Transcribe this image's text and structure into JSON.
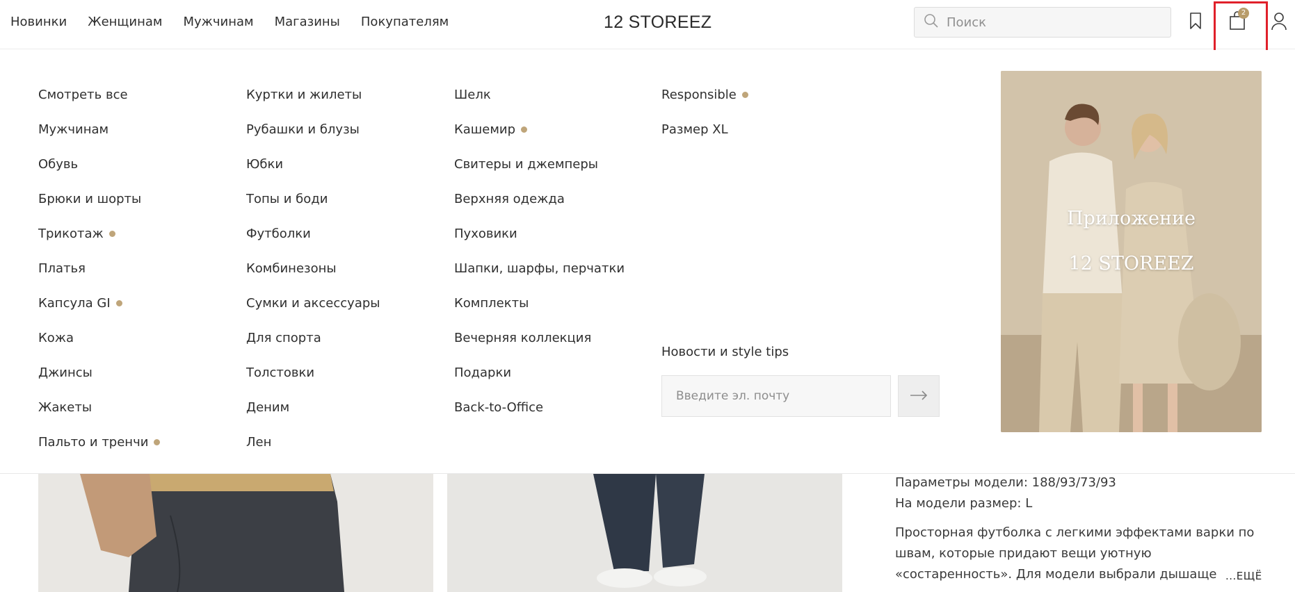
{
  "header": {
    "nav": [
      "Новинки",
      "Женщинам",
      "Мужчинам",
      "Магазины",
      "Покупателям"
    ],
    "logo": "12 STOREEZ",
    "search_placeholder": "Поиск",
    "cart_count": "2"
  },
  "menu": {
    "col1": [
      "Смотреть все",
      "Мужчинам",
      "Обувь",
      "Брюки и шорты",
      "Трикотаж",
      "Платья",
      "Капсула GI",
      "Кожа",
      "Джинсы",
      "Жакеты",
      "Пальто и тренчи"
    ],
    "col2": [
      "Куртки и жилеты",
      "Рубашки и блузы",
      "Юбки",
      "Топы и боди",
      "Футболки",
      "Комбинезоны",
      "Сумки и аксессуары",
      "Для спорта",
      "Толстовки",
      "Деним",
      "Лен"
    ],
    "col3": [
      "Шелк",
      "Кашемир",
      "Свитеры и джемперы",
      "Верхняя одежда",
      "Пуховики",
      "Шапки, шарфы, перчатки",
      "Комплекты",
      "Вечерняя коллекция",
      "Подарки",
      "Back-to-Office"
    ],
    "col4": [
      "Responsible",
      "Размер XL"
    ],
    "accent_color": "#bfa57a"
  },
  "newsletter": {
    "title": "Новости и style tips",
    "placeholder": "Введите эл. почту"
  },
  "promo": {
    "line1": "Приложение",
    "line2": "12 STOREEZ"
  },
  "product": {
    "params": "Параметры модели: 188/93/73/93",
    "size": "На модели размер: L",
    "description": "Просторная футболка с легкими эффектами варки по швам, которые придают вещи уютную «состаренность». Для модели выбрали дышаще",
    "more": "...ЕЩЁ"
  }
}
